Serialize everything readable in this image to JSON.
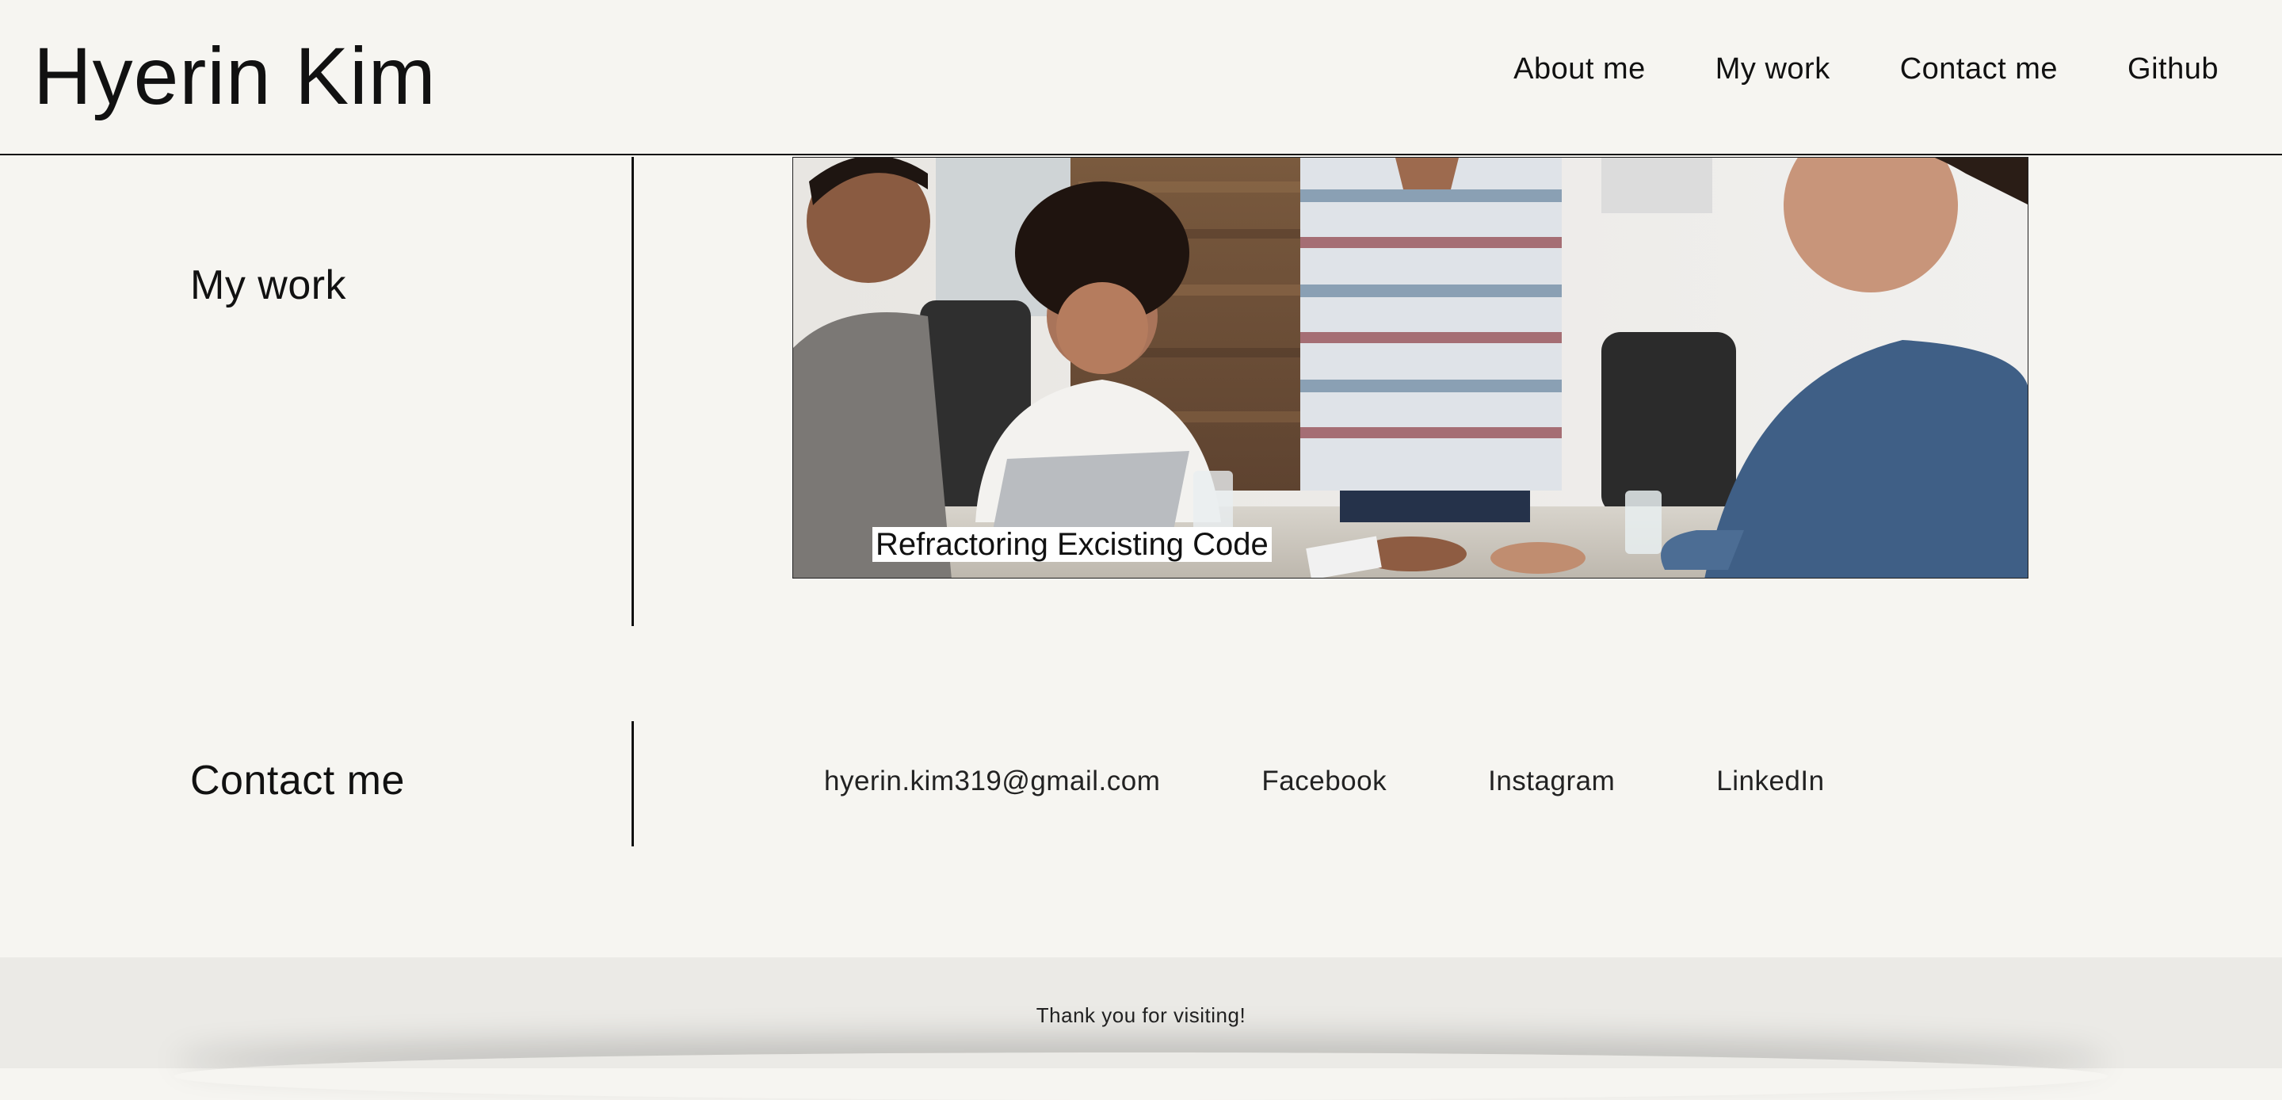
{
  "header": {
    "title": "Hyerin Kim",
    "nav": [
      "About me",
      "My work",
      "Contact me",
      "Github"
    ]
  },
  "work": {
    "section_title": "My work",
    "project_caption": "Refractoring Excisting Code"
  },
  "contact": {
    "section_title": "Contact me",
    "links": [
      "hyerin.kim319@gmail.com",
      "Facebook",
      "Instagram",
      "LinkedIn"
    ]
  },
  "footer": {
    "text": "Thank you for visiting!"
  },
  "colors": {
    "background": "#f6f5f1",
    "footer_bg": "#ebeae6",
    "text": "#111111"
  }
}
